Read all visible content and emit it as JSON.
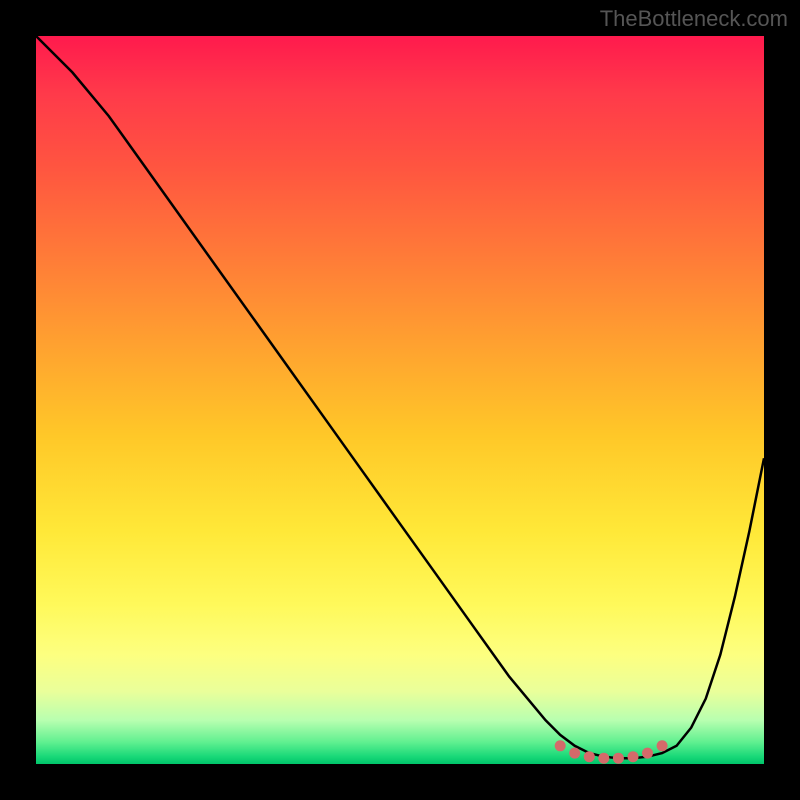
{
  "watermark": "TheBottleneck.com",
  "chart_data": {
    "type": "line",
    "title": "",
    "xlabel": "",
    "ylabel": "",
    "xlim": [
      0,
      100
    ],
    "ylim": [
      0,
      100
    ],
    "series": [
      {
        "name": "curve",
        "x": [
          0,
          5,
          10,
          15,
          20,
          25,
          30,
          35,
          40,
          45,
          50,
          55,
          60,
          65,
          70,
          72,
          74,
          76,
          78,
          80,
          82,
          84,
          86,
          88,
          90,
          92,
          94,
          96,
          98,
          100
        ],
        "y": [
          100,
          95,
          89,
          82,
          75,
          68,
          61,
          54,
          47,
          40,
          33,
          26,
          19,
          12,
          6,
          4,
          2.5,
          1.5,
          1,
          0.8,
          0.8,
          1,
          1.5,
          2.5,
          5,
          9,
          15,
          23,
          32,
          42
        ]
      }
    ],
    "flat_dots": {
      "x": [
        72,
        74,
        76,
        78,
        80,
        82,
        84,
        86
      ],
      "y": [
        2.5,
        1.5,
        1.0,
        0.8,
        0.8,
        1.0,
        1.5,
        2.5
      ],
      "color": "#d46a6a"
    },
    "colors": {
      "top": "#ff1a4d",
      "mid": "#ffe838",
      "bottom": "#00c46a",
      "line": "#000000",
      "dots": "#d46a6a",
      "background_frame": "#000000"
    }
  }
}
